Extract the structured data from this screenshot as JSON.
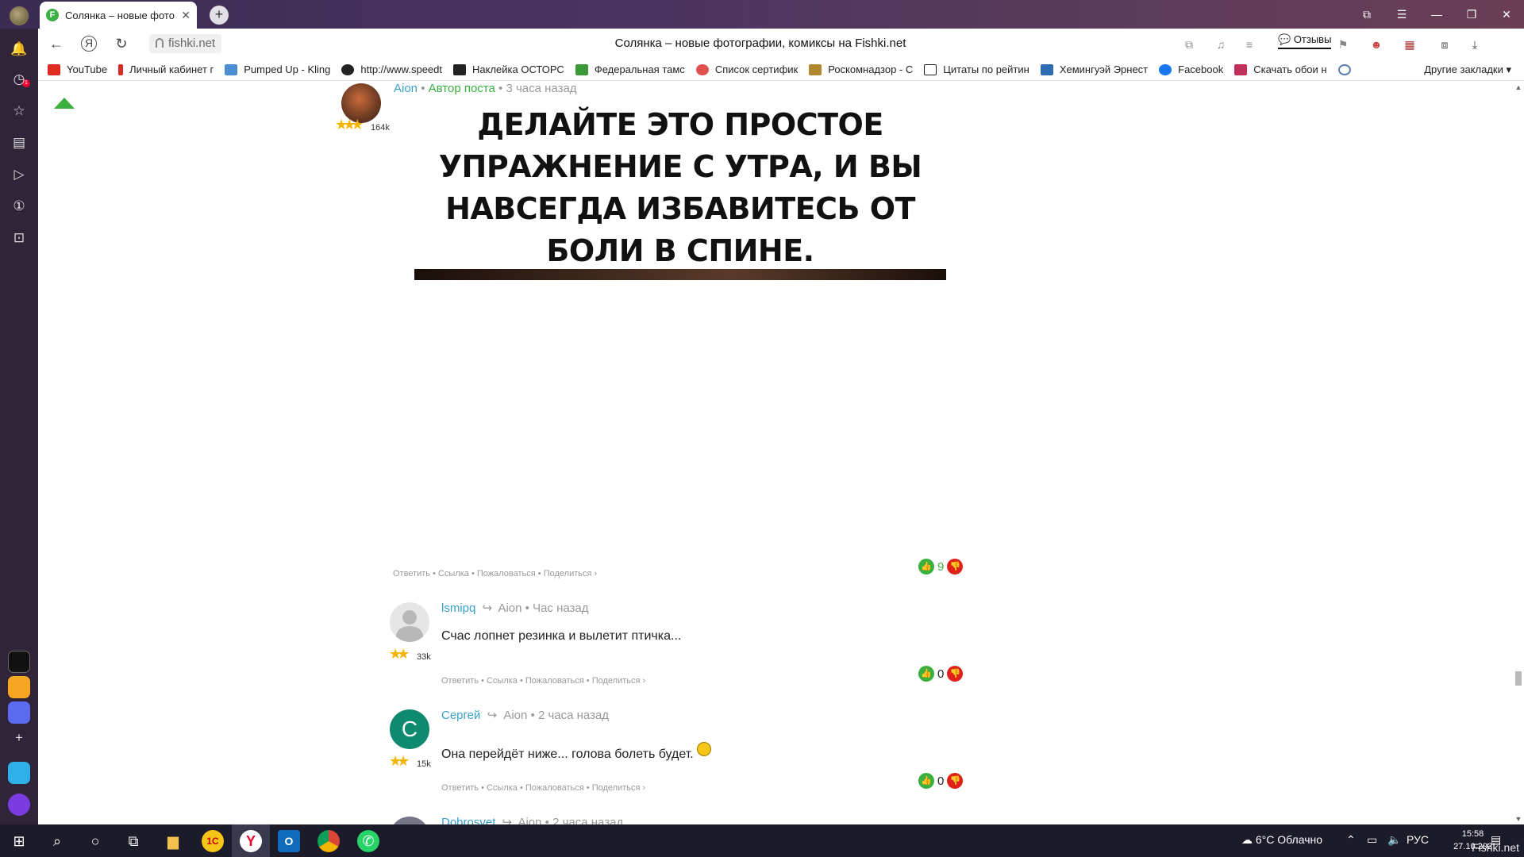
{
  "browser": {
    "tab_title": "Солянка – новые фото",
    "tab_favicon_letter": "F",
    "url": "fishki.net",
    "page_title": "Солянка – новые фотографии, комиксы на Fishki.net",
    "reviews_label": "Отзывы",
    "notification_count": "1"
  },
  "bookmarks": {
    "items": [
      {
        "label": "YouTube",
        "color": "#e02b20"
      },
      {
        "label": "Личный кабинет г",
        "color": "#d62b1f"
      },
      {
        "label": "Pumped Up - Kling",
        "color": "#4a8fd0"
      },
      {
        "label": "http://www.speedt",
        "color": "#222222"
      },
      {
        "label": "Наклейка ОСТОРС",
        "color": "#222222"
      },
      {
        "label": "Федеральная тамс",
        "color": "#3a9a3a"
      },
      {
        "label": "Список сертифик",
        "color": "#e05050"
      },
      {
        "label": "Роскомнадзор - С",
        "color": "#b08830"
      },
      {
        "label": "Цитаты по рейтин",
        "color": "#222222"
      },
      {
        "label": "Хемингуэй Эрнест",
        "color": "#2d6cb5"
      },
      {
        "label": "Facebook",
        "color": "#1877f2"
      },
      {
        "label": "Скачать обои н",
        "color": "#c0305a"
      }
    ],
    "more_label": "Другие закладки"
  },
  "post": {
    "author": "Aion",
    "author_badge": "Автор поста",
    "time": "3 часа назад",
    "rating": "164k",
    "image_text": "ДЕЛАЙТЕ ЭТО ПРОСТОЕ УПРАЖНЕНИЕ С УТРА, И ВЫ НАВСЕГДА ИЗБАВИТЕСЬ ОТ БОЛИ В СПИНЕ.",
    "image_lines": [
      "ДЕЛАЙТЕ ЭТО ПРОСТОЕ",
      "УПРАЖНЕНИЕ С УТРА, И ВЫ",
      "НАВСЕГДА ИЗБАВИТЕСЬ ОТ",
      "БОЛИ В СПИНЕ."
    ],
    "actions": "Ответить • Ссылка • Пожаловаться • Поделиться ›",
    "votes": "9"
  },
  "comments": [
    {
      "user": "lsmipq",
      "reply_to": "Aion",
      "time": "Час назад",
      "rating": "33k",
      "text": "Счас лопнет резинка и вылетит птичка...",
      "actions": "Ответить • Ссылка • Пожаловаться • Поделиться ›",
      "votes": "0"
    },
    {
      "user": "Сергей",
      "avatar_letter": "С",
      "reply_to": "Aion",
      "time": "2 часа назад",
      "rating": "15k",
      "text": "Она перейдёт ниже... голова болеть будет.",
      "actions": "Ответить • Ссылка • Пожаловаться • Поделиться ›",
      "votes": "0"
    },
    {
      "user": "Dobrosvet",
      "reply_to": "Aion",
      "time": "2 часа назад"
    }
  ],
  "taskbar": {
    "weather": "6°C Облачно",
    "lang": "РУС",
    "time": "15:58",
    "date": "27.10.202",
    "watermark": "Fishki.net"
  },
  "colors": {
    "accent_green": "#3ab03e",
    "link_blue": "#3aa0c8",
    "downvote_red": "#e0211b",
    "sidebar_bg": "#2f2438"
  }
}
